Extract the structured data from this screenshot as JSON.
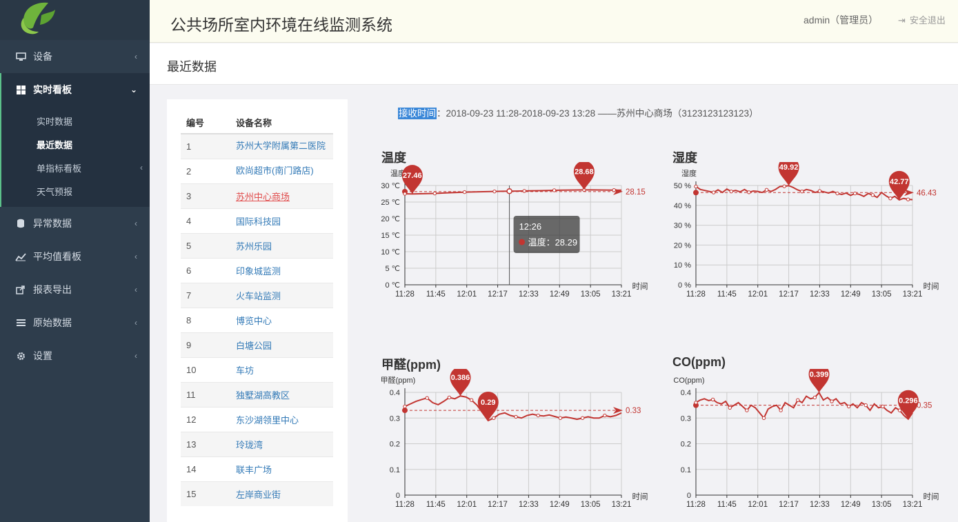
{
  "app": {
    "title": "公共场所室内环境在线监测系统",
    "user": "admin（管理员）",
    "logout": "安全退出"
  },
  "sidebar": {
    "items": [
      {
        "label": "设备",
        "icon": "monitor-icon"
      },
      {
        "label": "实时看板",
        "icon": "grid-icon"
      },
      {
        "label": "异常数据",
        "icon": "database-icon"
      },
      {
        "label": "平均值看板",
        "icon": "line-chart-icon"
      },
      {
        "label": "报表导出",
        "icon": "export-icon"
      },
      {
        "label": "原始数据",
        "icon": "list-icon"
      },
      {
        "label": "设置",
        "icon": "gear-icon"
      }
    ],
    "sub": [
      {
        "label": "实时数据"
      },
      {
        "label": "最近数据"
      },
      {
        "label": "单指标看板"
      },
      {
        "label": "天气预报"
      }
    ]
  },
  "page": {
    "title": "最近数据"
  },
  "device_table": {
    "headers": [
      "编号",
      "设备名称"
    ],
    "rows": [
      [
        "1",
        "苏州大学附属第二医院"
      ],
      [
        "2",
        "欧尚超市(南门路店)"
      ],
      [
        "3",
        "苏州中心商场"
      ],
      [
        "4",
        "国际科技园"
      ],
      [
        "5",
        "苏州乐园"
      ],
      [
        "6",
        "印象城监测"
      ],
      [
        "7",
        "火车站监测"
      ],
      [
        "8",
        "博览中心"
      ],
      [
        "9",
        "白塘公园"
      ],
      [
        "10",
        "车坊"
      ],
      [
        "11",
        "独墅湖高教区"
      ],
      [
        "12",
        "东沙湖领里中心"
      ],
      [
        "13",
        "玲珑湾"
      ],
      [
        "14",
        "联丰广场"
      ],
      [
        "15",
        "左岸商业街"
      ]
    ]
  },
  "receive": {
    "label": "接收时间",
    "text": "：2018-09-23 11:28-2018-09-23 13:28 ——苏州中心商场（3123123123123）"
  },
  "colors": {
    "series": "#c23531",
    "grid": "#cccccc"
  },
  "chart_data": [
    {
      "type": "line",
      "title": "温度",
      "ylabel": "温度",
      "xlabel": "时间",
      "x": [
        "11:28",
        "11:45",
        "12:01",
        "12:17",
        "12:33",
        "12:49",
        "13:05",
        "13:21"
      ],
      "yticks": [
        "0 ℃",
        "5 ℃",
        "10 ℃",
        "15 ℃",
        "20 ℃",
        "25 ℃",
        "30 ℃"
      ],
      "ylim": [
        0,
        30
      ],
      "values": [
        27.5,
        27.46,
        27.5,
        27.55,
        27.6,
        27.7,
        27.8,
        27.9,
        28.0,
        28.05,
        28.1,
        28.15,
        28.2,
        28.25,
        28.29,
        28.3,
        28.35,
        28.4,
        28.45,
        28.5,
        28.55,
        28.6,
        28.62,
        28.65,
        28.68,
        28.66,
        28.64,
        28.62,
        28.6,
        28.6
      ],
      "min": {
        "label": "27.46",
        "i": 1
      },
      "max": {
        "label": "28.68",
        "i": 24
      },
      "avg": 28.15,
      "avg_label": "28.15",
      "tooltip": {
        "time": "12:26",
        "text": "温度：28.29"
      }
    },
    {
      "type": "line",
      "title": "湿度",
      "ylabel": "湿度",
      "xlabel": "时间",
      "x": [
        "11:28",
        "11:45",
        "12:01",
        "12:17",
        "12:33",
        "12:49",
        "13:05",
        "13:21"
      ],
      "yticks": [
        "0 %",
        "10 %",
        "20 %",
        "30 %",
        "40 %",
        "50 %"
      ],
      "ylim": [
        0,
        50
      ],
      "values": [
        49.5,
        48.0,
        47.5,
        47.0,
        46.5,
        47.8,
        46.5,
        48.2,
        47.0,
        47.5,
        46.8,
        48.0,
        46.6,
        47.2,
        47.0,
        46.5,
        47.8,
        47.0,
        48.0,
        49.5,
        49.6,
        49.92,
        49.0,
        47.8,
        47.0,
        48.0,
        47.5,
        46.5,
        47.2,
        46.8,
        46.2,
        47.0,
        46.0,
        45.5,
        46.2,
        45.0,
        46.0,
        45.5,
        44.5,
        46.0,
        45.2,
        44.0,
        46.5,
        44.8,
        43.5,
        44.5,
        42.77,
        43.5,
        43.0,
        42.9
      ],
      "min": {
        "label": "42.77",
        "i": 46
      },
      "max": {
        "label": "49.92",
        "i": 21
      },
      "avg": 46.43,
      "avg_label": "46.43"
    },
    {
      "type": "line",
      "title": "甲醛(ppm)",
      "ylabel": "甲醛(ppm)",
      "xlabel": "时间",
      "x": [
        "11:28",
        "11:45",
        "12:01",
        "12:17",
        "12:33",
        "12:49",
        "13:05",
        "13:21"
      ],
      "yticks": [
        "0",
        "0.1",
        "0.2",
        "0.3",
        "0.4"
      ],
      "ylim": [
        0,
        0.4
      ],
      "values": [
        0.345,
        0.355,
        0.365,
        0.372,
        0.378,
        0.36,
        0.352,
        0.365,
        0.38,
        0.375,
        0.386,
        0.382,
        0.37,
        0.35,
        0.32,
        0.29,
        0.3,
        0.315,
        0.32,
        0.31,
        0.305,
        0.3,
        0.31,
        0.315,
        0.31,
        0.308,
        0.312,
        0.306,
        0.3,
        0.304,
        0.3,
        0.295,
        0.3,
        0.305,
        0.3,
        0.3,
        0.31,
        0.305,
        0.31,
        0.32
      ],
      "min": {
        "label": "0.29",
        "i": 15
      },
      "max": {
        "label": "0.386",
        "i": 10
      },
      "avg": 0.33,
      "avg_label": "0.33"
    },
    {
      "type": "line",
      "title": "CO(ppm)",
      "ylabel": "CO(ppm)",
      "xlabel": "时间",
      "x": [
        "11:28",
        "11:45",
        "12:01",
        "12:17",
        "12:33",
        "12:49",
        "13:05",
        "13:21"
      ],
      "yticks": [
        "0",
        "0.1",
        "0.2",
        "0.3",
        "0.4"
      ],
      "ylim": [
        0,
        0.4
      ],
      "values": [
        0.36,
        0.37,
        0.375,
        0.368,
        0.372,
        0.36,
        0.355,
        0.365,
        0.34,
        0.35,
        0.36,
        0.345,
        0.33,
        0.35,
        0.34,
        0.32,
        0.3,
        0.335,
        0.345,
        0.35,
        0.33,
        0.36,
        0.35,
        0.34,
        0.37,
        0.36,
        0.385,
        0.375,
        0.38,
        0.399,
        0.37,
        0.38,
        0.365,
        0.375,
        0.355,
        0.36,
        0.345,
        0.355,
        0.34,
        0.36,
        0.35,
        0.33,
        0.355,
        0.34,
        0.345,
        0.33,
        0.32,
        0.34,
        0.33,
        0.31,
        0.296,
        0.32
      ],
      "min": {
        "label": "0.296",
        "i": 50
      },
      "max": {
        "label": "0.399",
        "i": 29
      },
      "avg": 0.35,
      "avg_label": "0.35"
    }
  ]
}
